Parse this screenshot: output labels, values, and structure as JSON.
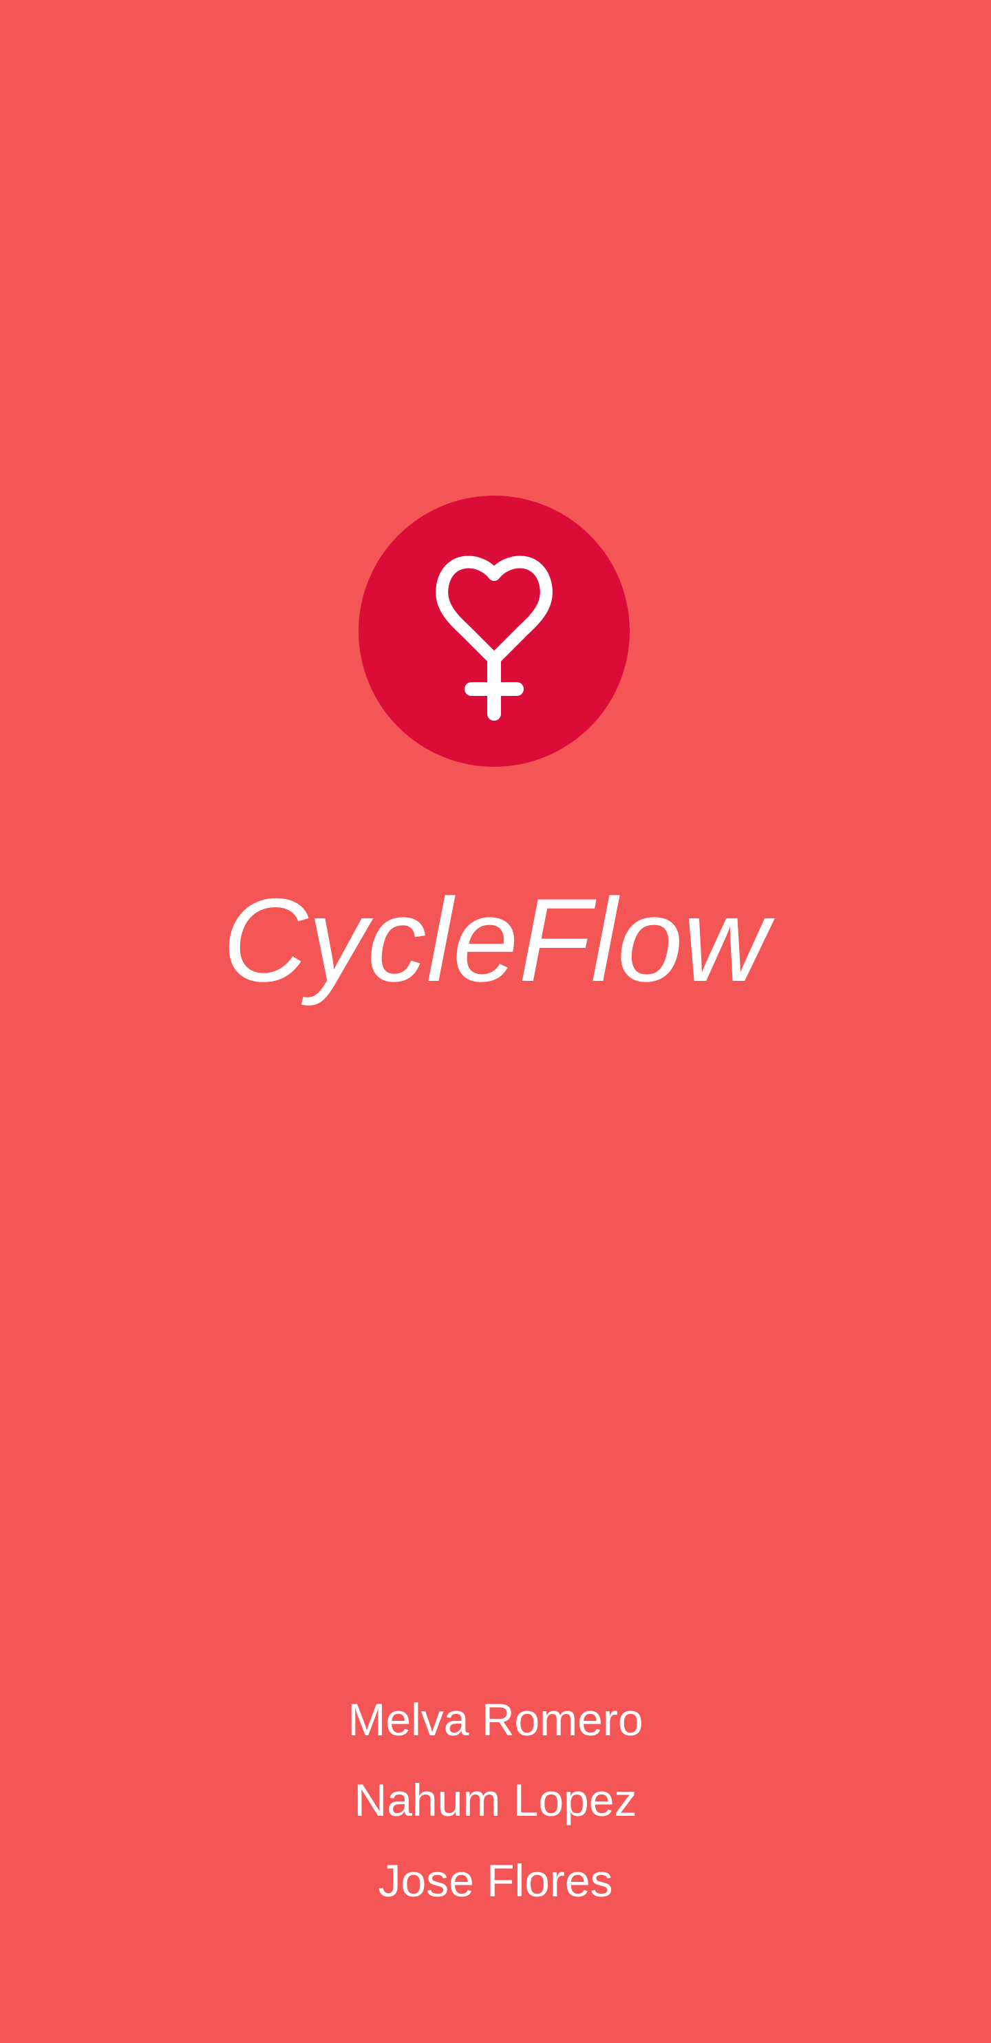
{
  "app": {
    "title": "CycleFlow",
    "logo_icon": "heart-venus-icon"
  },
  "authors": [
    "Melva Romero",
    "Nahum Lopez",
    "Jose Flores"
  ],
  "colors": {
    "background": "#f45656",
    "logo_circle": "#dc0c38",
    "text": "#ffffff"
  }
}
